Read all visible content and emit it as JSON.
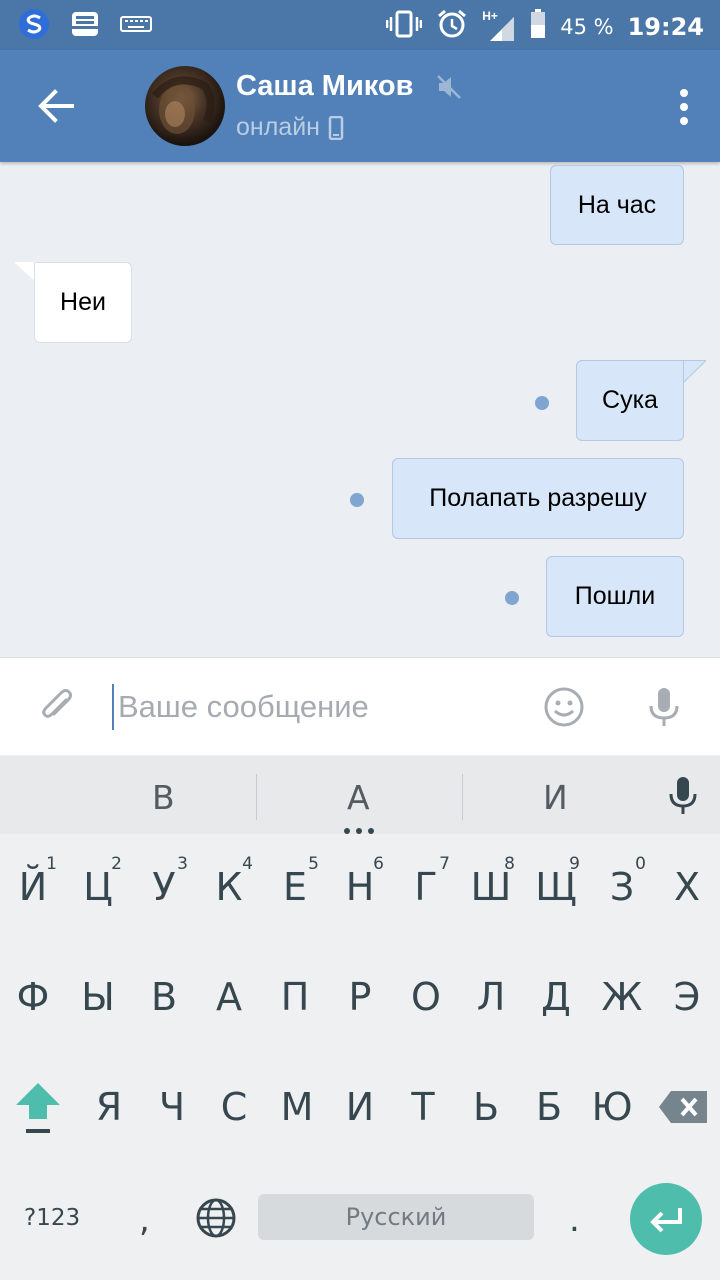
{
  "status_bar": {
    "network": "H+",
    "battery_pct": "45 %",
    "time": "19:24"
  },
  "header": {
    "contact_name": "Саша Миков",
    "status": "онлайн"
  },
  "messages": [
    {
      "text": "На час",
      "direction": "out"
    },
    {
      "text": "Неи",
      "direction": "in"
    },
    {
      "text": "Сука",
      "direction": "out",
      "unread": true
    },
    {
      "text": "Полапать разрешу",
      "direction": "out",
      "unread": true
    },
    {
      "text": "Пошли",
      "direction": "out",
      "unread": true
    }
  ],
  "composer": {
    "placeholder": "Ваше сообщение"
  },
  "suggestions": [
    "В",
    "А",
    "И"
  ],
  "keyboard": {
    "row1": [
      "Й",
      "Ц",
      "У",
      "К",
      "Е",
      "Н",
      "Г",
      "Ш",
      "Щ",
      "З",
      "Х"
    ],
    "row1_hints": [
      "1",
      "2",
      "3",
      "4",
      "5",
      "6",
      "7",
      "8",
      "9",
      "0",
      ""
    ],
    "row2": [
      "Ф",
      "Ы",
      "В",
      "А",
      "П",
      "Р",
      "О",
      "Л",
      "Д",
      "Ж",
      "Э"
    ],
    "row3": [
      "Я",
      "Ч",
      "С",
      "М",
      "И",
      "Т",
      "Ь",
      "Б",
      "Ю"
    ],
    "symbols_label": "?123",
    "comma": ",",
    "period": ".",
    "space_label": "Русский"
  },
  "colors": {
    "header": "#5181b8",
    "status_bar": "#4a76a8",
    "outgoing_bubble": "#d7e6f8",
    "enter": "#4fbdac"
  }
}
